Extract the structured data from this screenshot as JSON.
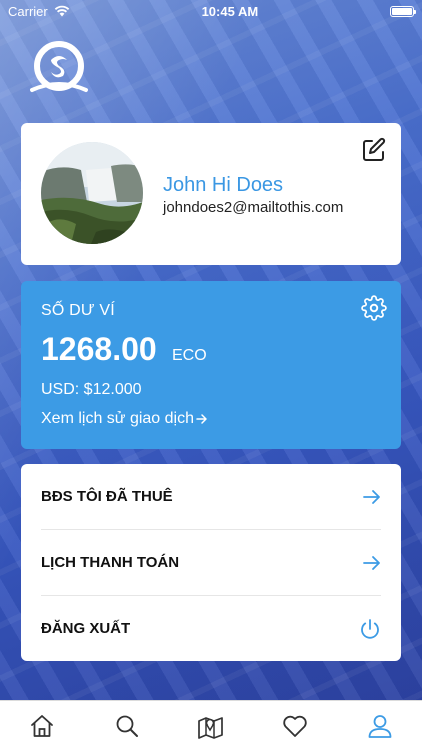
{
  "status_bar": {
    "carrier": "Carrier",
    "time": "10:45 AM",
    "battery_level": 1.0
  },
  "profile": {
    "name": "John Hi Does",
    "email": "johndoes2@mailtothis.com"
  },
  "wallet": {
    "title": "SỐ DƯ VÍ",
    "amount": "1268.00",
    "unit": "ECO",
    "usd": "USD: $12.000",
    "history_link": "Xem lịch sử giao dịch"
  },
  "menu": {
    "items": [
      {
        "label": "BĐS TÔI ĐÃ THUÊ",
        "icon": "arrow-right-icon"
      },
      {
        "label": "LỊCH THANH TOÁN",
        "icon": "arrow-right-icon"
      },
      {
        "label": "ĐĂNG XUẤT",
        "icon": "power-icon"
      }
    ]
  },
  "tab_bar": {
    "tabs": [
      {
        "name": "home",
        "icon": "home-icon",
        "active": false
      },
      {
        "name": "search",
        "icon": "search-icon",
        "active": false
      },
      {
        "name": "map",
        "icon": "map-icon",
        "active": false
      },
      {
        "name": "favorites",
        "icon": "heart-icon",
        "active": false
      },
      {
        "name": "profile",
        "icon": "user-icon",
        "active": true
      }
    ]
  },
  "colors": {
    "accent": "#3c9be5",
    "name_text": "#3a97e3",
    "icon_default": "#333333",
    "icon_active": "#3c9be5"
  }
}
